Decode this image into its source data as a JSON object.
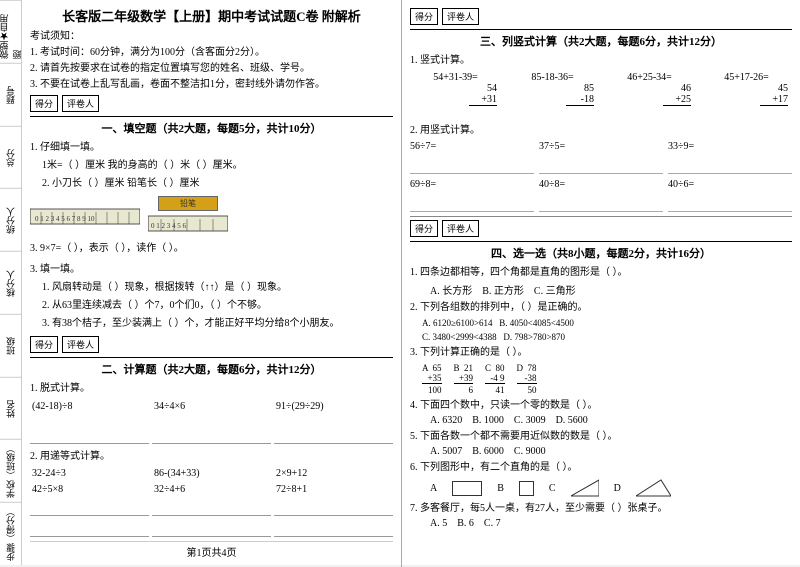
{
  "topbar": {
    "label1": "微塑★自用题",
    "label2": "题号",
    "label3": "总分",
    "label4": "统分人",
    "label5": "核分人",
    "label6": "班级",
    "label7": "姓名",
    "label8": "学校（班级）",
    "label9": "步骤（得分）"
  },
  "paper": {
    "title": "长客版二年级数学【上册】期中考试试题C卷 附解析",
    "instructions_title": "考试须知：",
    "instructions": [
      "1. 考试时间：60分钟，满分为100分（含客面分2分）。",
      "2. 请首先按要求在试卷的指定位置填写您的姓名、班级、学号。",
      "3. 不要在试卷上乱写乱画，卷面不整洁扣1分，密封线外请勿作答。"
    ],
    "section1": {
      "title": "一、填空题（共2大题，每题5分，共计10分）",
      "q1_label": "得分",
      "q1_reviewer": "评卷人",
      "q1_title": "1. 仔细填一填。",
      "q1_a": "1米=（    ）厘米  我的身高的（    ）米（    ）厘米。",
      "q1_b": "2. 小刀长（    ）厘米  铅笔长（    ）厘米",
      "q2_title": "3. 9×7=（    ），表示（    ），读作（    ）。",
      "q3_title": "3. 填一填。",
      "q3_a": "1. 风扇转动是（  ）现象，根据拨转（↑↑）是（  ）现象。",
      "q3_b": "2. 从63里连续减去（  ）个7，0个们0，（  ）个不够。",
      "q3_c": "3. 有38个桔子，至少装满上（  ）个，才能正好平均分给8个小朋友。"
    },
    "section2": {
      "title": "二、计算题（共2大题，每题6分，共计12分）",
      "q1_label": "得分",
      "q1_reviewer": "评卷人",
      "q1_title": "1. 脱式计算。",
      "calcs": [
        "(42-18)÷8",
        "34÷4×6",
        "91÷(29÷29)"
      ],
      "q2_title": "2. 用递等式计算。",
      "calcs2": [
        "32-24÷3",
        "86-(34+33)",
        "2×9+12",
        "42÷5×8",
        "32÷4+6",
        "72÷8+1"
      ]
    },
    "section3": {
      "title": "三、列竖式计算（共2大题，每题6分，共计12分）",
      "q1_label": "得分",
      "q1_reviewer": "评卷人",
      "q1_title": "1. 竖式计算。",
      "vcalcs": [
        {
          "expr": "54+31-39=",
          "num1": "54",
          "op1": "+",
          "num2": "31",
          "result": ""
        },
        {
          "expr": "85-18-36=",
          "num1": "85",
          "op1": "-",
          "num2": "18",
          "result": ""
        },
        {
          "expr": "46+25-34=",
          "num1": "46",
          "op1": "+",
          "num2": "25",
          "result": ""
        },
        {
          "expr": "45+17-26=",
          "num1": "45",
          "op1": "+",
          "num2": "17",
          "result": ""
        }
      ],
      "q2_title": "2. 用竖式计算。",
      "vcalcs2": [
        {
          "expr": "56÷7=",
          "num1": "56",
          "op": "÷",
          "num2": "7"
        },
        {
          "expr": "37÷5=",
          "num1": "37",
          "op": "÷",
          "num2": "5"
        },
        {
          "expr": "33÷9=",
          "num1": "33",
          "op": "÷",
          "num2": "9"
        },
        {
          "expr": "69÷8=",
          "num1": "69",
          "op": "÷",
          "num2": "8"
        },
        {
          "expr": "40÷8=",
          "num1": "40",
          "op": "÷",
          "num2": "8"
        },
        {
          "expr": "40÷6=",
          "num1": "40",
          "op": "÷",
          "num2": "6"
        }
      ]
    },
    "section4": {
      "title": "四、选一选（共8小题，每题2分，共计16分）",
      "q1_label": "得分",
      "q1_reviewer": "评卷人",
      "questions": [
        {
          "text": "1. 四条边都相等，四个角都是直角的图形是（  ）。",
          "options": [
            "A. 长方形",
            "B. 正方形",
            "C. 三角形"
          ]
        },
        {
          "text": "2. 下列各组数的排列中，（  ）是正确的。",
          "options": [
            "A. 6120≥6100>614",
            "B. 4050<4085<4500",
            "C. 3480<2999<4388",
            "D. 798>780>870"
          ]
        },
        {
          "text": "3. 下列计算正确的是（  ）。",
          "vcalcs_display": [
            {
              "label": "A 65",
              "add": "+35",
              "result": "100"
            },
            {
              "label": "B 21",
              "add": "+39",
              "result": "6"
            },
            {
              "label": "C 80",
              "add": "-49",
              "result": "41"
            },
            {
              "label": "D 78",
              "add": "-38",
              "result": "50"
            }
          ]
        },
        {
          "text": "4. 下面四个数中，只读一个零的数是（  ）。",
          "options": [
            "A. 6320",
            "B. 1000",
            "C. 3009",
            "D. 5600"
          ]
        },
        {
          "text": "5. 下面各数一个都不需要用近似数的数是（  ）。",
          "options": [
            "A. 5007",
            "B. 6000",
            "C. 9000"
          ]
        },
        {
          "text": "6. 下列图形中，有二个直角的是（  ）。",
          "shape_labels": [
            "A",
            "B",
            "C",
            "D"
          ]
        },
        {
          "text": "7. 多客餐厅，每5人一桌，有27人，至少需要（  ）张桌子。",
          "options": [
            "A. 5",
            "B. 6",
            "C. 7"
          ]
        }
      ]
    },
    "footer": "第1页共4页"
  }
}
